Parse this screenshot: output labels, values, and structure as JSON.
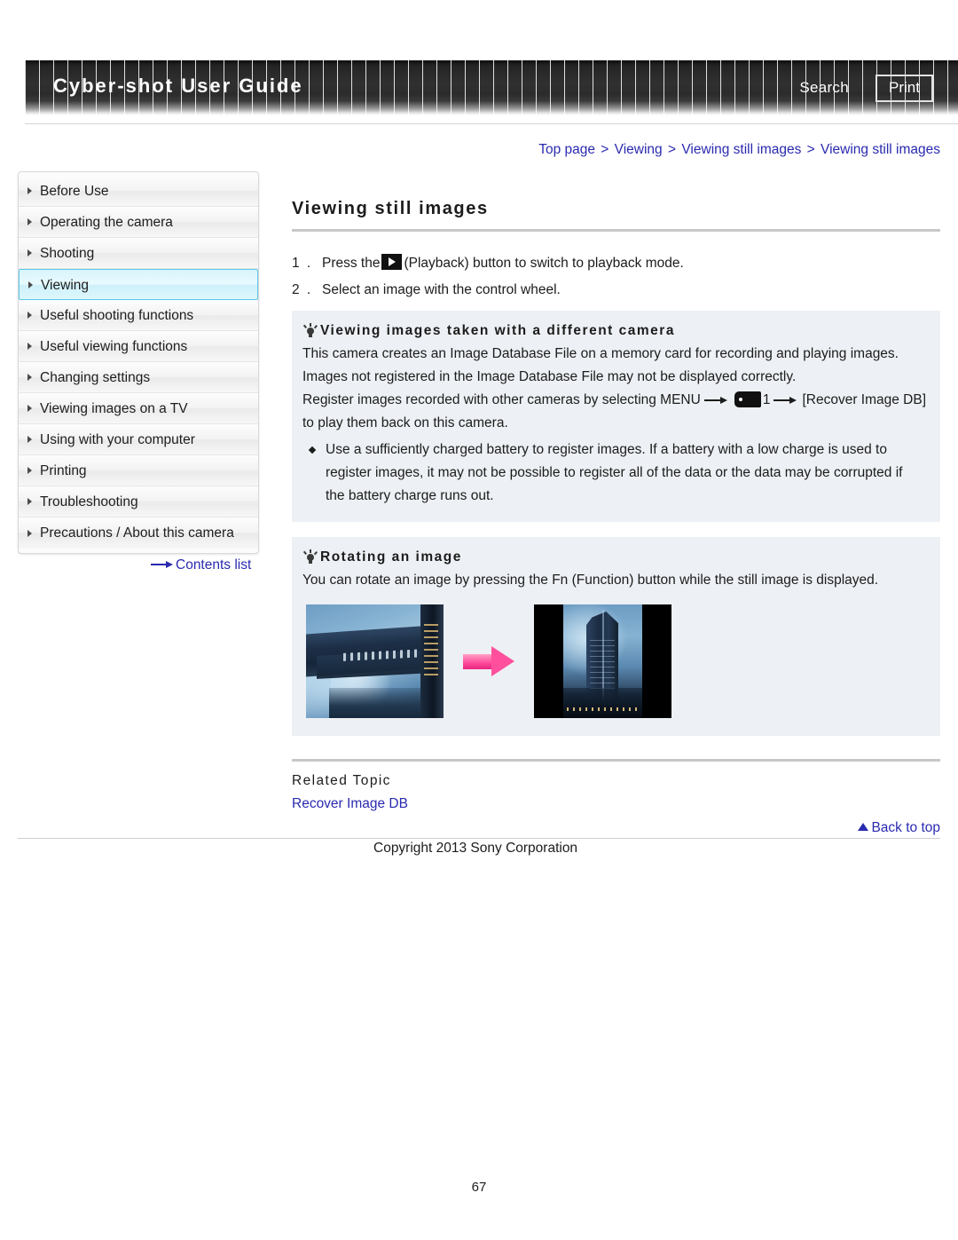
{
  "header": {
    "title": "Cyber-shot User Guide",
    "search_label": "Search",
    "print_label": "Print"
  },
  "breadcrumb": {
    "items": [
      {
        "label": "Top page"
      },
      {
        "label": "Viewing"
      },
      {
        "label": "Viewing still images"
      },
      {
        "label": "Viewing still images"
      }
    ],
    "separator": ">"
  },
  "sidebar": {
    "items": [
      {
        "label": "Before Use",
        "active": false
      },
      {
        "label": "Operating the camera",
        "active": false
      },
      {
        "label": "Shooting",
        "active": false
      },
      {
        "label": "Viewing",
        "active": true
      },
      {
        "label": "Useful shooting functions",
        "active": false
      },
      {
        "label": "Useful viewing functions",
        "active": false
      },
      {
        "label": "Changing settings",
        "active": false
      },
      {
        "label": "Viewing images on a TV",
        "active": false
      },
      {
        "label": "Using with your computer",
        "active": false
      },
      {
        "label": "Printing",
        "active": false
      },
      {
        "label": "Troubleshooting",
        "active": false
      },
      {
        "label": "Precautions / About this camera",
        "active": false
      }
    ],
    "contents_list_label": "Contents list"
  },
  "main": {
    "page_title": "Viewing still images",
    "steps": [
      {
        "number": "1 .",
        "text_before_icon": "Press the",
        "icon": "playback-icon",
        "text_after_icon": "(Playback) button to switch to playback mode."
      },
      {
        "number": "2 .",
        "text_before_icon": "Select an image with the control wheel.",
        "icon": "",
        "text_after_icon": ""
      }
    ],
    "tip_boxes": [
      {
        "icon": "lightbulb-icon",
        "heading": "Viewing images taken with a different camera",
        "line1": "This camera creates an Image Database File on a memory card for recording and playing images.",
        "line2": "Images not registered in the Image Database File may not be displayed correctly.",
        "line3_part1": "Register images recorded with other cameras by selecting MENU",
        "line3_menu_icon": "menu-tag-icon",
        "line3_part2": "1",
        "line3_part3": "[Recover Image DB]",
        "line4": "to play them back on this camera.",
        "bullets": [
          "Use a sufficiently charged battery to register images. If a battery with a low charge is used to register images, it may not be possible to register all of the data or the data may be corrupted if the battery charge runs out."
        ]
      },
      {
        "icon": "lightbulb-icon",
        "heading": "Rotating an image",
        "line1": "You can rotate an image by pressing the Fn (Function) button while the still image is displayed.",
        "figure": {
          "left_photo_alt": "skyscraper photo rotated sideways",
          "arrow": "pink-right-arrow",
          "right_photo_alt": "skyscraper photo upright with black side bars"
        }
      }
    ],
    "related_topic_heading": "Related Topic",
    "related_topic_link": "Recover Image DB"
  },
  "footer": {
    "back_to_top": "Back to top",
    "copyright": "Copyright 2013 Sony Corporation",
    "page_number": "67"
  },
  "colors": {
    "link_blue": "#2a2ab0",
    "tip_background": "#edf0f4",
    "active_nav_border": "#5ec8e8",
    "arrow_pink": "#ff4f9d"
  }
}
